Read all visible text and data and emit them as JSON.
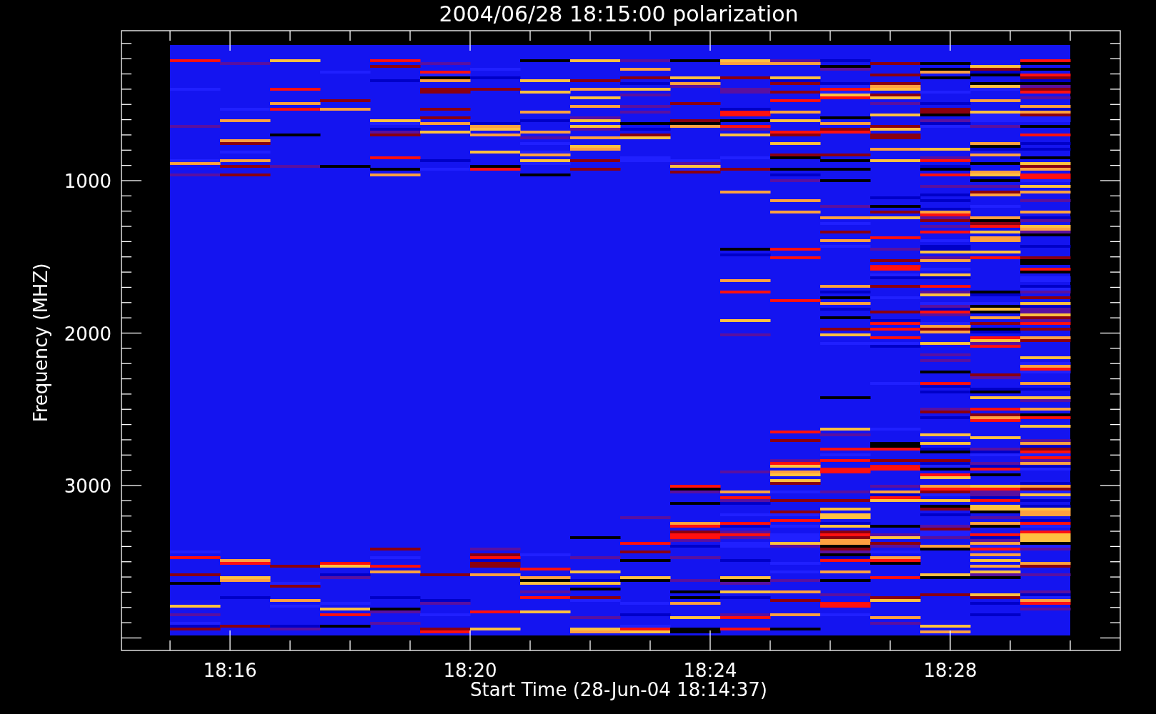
{
  "title": "2004/06/28 18:15:00 polarization",
  "y_axis": {
    "label": "Frequency (MHZ)",
    "ticks": [
      "1000",
      "2000",
      "3000"
    ]
  },
  "x_axis": {
    "label": "Start Time (28-Jun-04 18:14:37)",
    "ticks": [
      "18:16",
      "18:20",
      "18:24",
      "18:28"
    ]
  },
  "plot": {
    "kind": "spectrogram"
  }
}
